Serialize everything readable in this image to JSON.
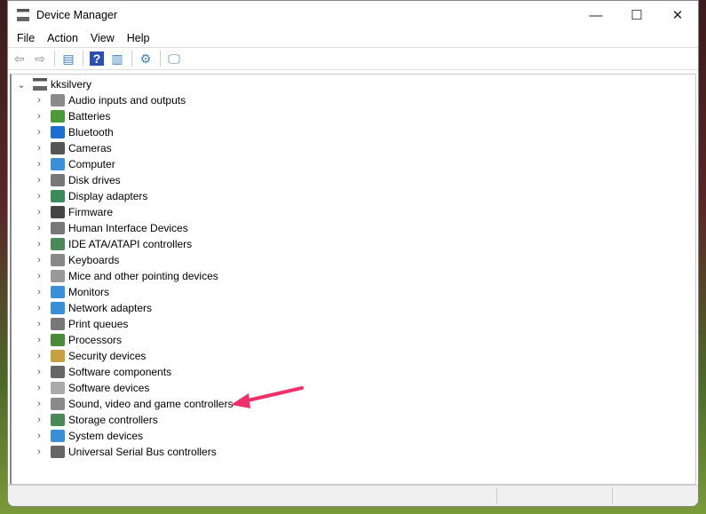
{
  "window": {
    "title": "Device Manager",
    "minimize": "—",
    "maximize": "☐",
    "close": "✕"
  },
  "menu": [
    "File",
    "Action",
    "View",
    "Help"
  ],
  "toolbar": [
    {
      "icon": "back-icon",
      "glyph": "⇦"
    },
    {
      "icon": "forward-icon",
      "glyph": "⇨"
    },
    {
      "icon": "show-hide-console-tree-icon",
      "glyph": "▤"
    },
    {
      "icon": "help-icon",
      "glyph": "?"
    },
    {
      "icon": "properties-icon",
      "glyph": "▥"
    },
    {
      "icon": "update-driver-icon",
      "glyph": "⚙"
    },
    {
      "icon": "scan-hardware-icon",
      "glyph": "🖵"
    }
  ],
  "tree": {
    "root": "kksilvery",
    "items": [
      {
        "label": "Audio inputs and outputs",
        "color": "#8a8a8a"
      },
      {
        "label": "Batteries",
        "color": "#4a9a3a"
      },
      {
        "label": "Bluetooth",
        "color": "#1a6fd0"
      },
      {
        "label": "Cameras",
        "color": "#555555"
      },
      {
        "label": "Computer",
        "color": "#3a8fd8"
      },
      {
        "label": "Disk drives",
        "color": "#777777"
      },
      {
        "label": "Display adapters",
        "color": "#3a8a5a"
      },
      {
        "label": "Firmware",
        "color": "#444444"
      },
      {
        "label": "Human Interface Devices",
        "color": "#777777"
      },
      {
        "label": "IDE ATA/ATAPI controllers",
        "color": "#4a8a5a"
      },
      {
        "label": "Keyboards",
        "color": "#888888"
      },
      {
        "label": "Mice and other pointing devices",
        "color": "#999999"
      },
      {
        "label": "Monitors",
        "color": "#3a8fd8"
      },
      {
        "label": "Network adapters",
        "color": "#3a8fd8"
      },
      {
        "label": "Print queues",
        "color": "#777777"
      },
      {
        "label": "Processors",
        "color": "#4a8a3a"
      },
      {
        "label": "Security devices",
        "color": "#c8a040"
      },
      {
        "label": "Software components",
        "color": "#666666"
      },
      {
        "label": "Software devices",
        "color": "#aaaaaa"
      },
      {
        "label": "Sound, video and game controllers",
        "color": "#8a8a8a"
      },
      {
        "label": "Storage controllers",
        "color": "#4a8a5a"
      },
      {
        "label": "System devices",
        "color": "#3a8fd8"
      },
      {
        "label": "Universal Serial Bus controllers",
        "color": "#666666"
      }
    ]
  },
  "annotation": {
    "arrow_color": "#f0306a"
  }
}
